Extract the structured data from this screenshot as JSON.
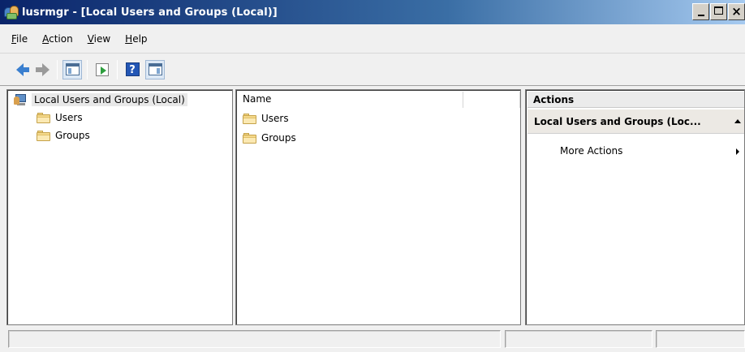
{
  "window": {
    "title": "lusrmgr - [Local Users and Groups (Local)]",
    "close_glyph": "×"
  },
  "menu": {
    "items": [
      {
        "mnemonic": "F",
        "rest": "ile"
      },
      {
        "mnemonic": "A",
        "rest": "ction"
      },
      {
        "mnemonic": "V",
        "rest": "iew"
      },
      {
        "mnemonic": "H",
        "rest": "elp"
      }
    ]
  },
  "toolbar": {
    "buttons": [
      "back-arrow-icon",
      "forward-arrow-icon",
      "show-hide-console-tree-icon",
      "export-list-icon",
      "help-icon",
      "show-hide-action-pane-icon"
    ],
    "help_glyph": "?"
  },
  "tree": {
    "root_label": "Local Users and Groups (Local)",
    "nodes": [
      {
        "label": "Users"
      },
      {
        "label": "Groups"
      }
    ]
  },
  "list": {
    "columns": [
      "Name",
      ""
    ],
    "rows": [
      {
        "name": "Users"
      },
      {
        "name": "Groups"
      }
    ]
  },
  "actions": {
    "header": "Actions",
    "section_title": "Local Users and Groups (Loc...",
    "items": [
      {
        "label": "More Actions"
      }
    ]
  },
  "colors": {
    "title_bar_start": "#0a246a",
    "title_bar_end": "#a6caf0",
    "selection_bg": "#e8e8e8",
    "folder": "#f5d98a"
  }
}
